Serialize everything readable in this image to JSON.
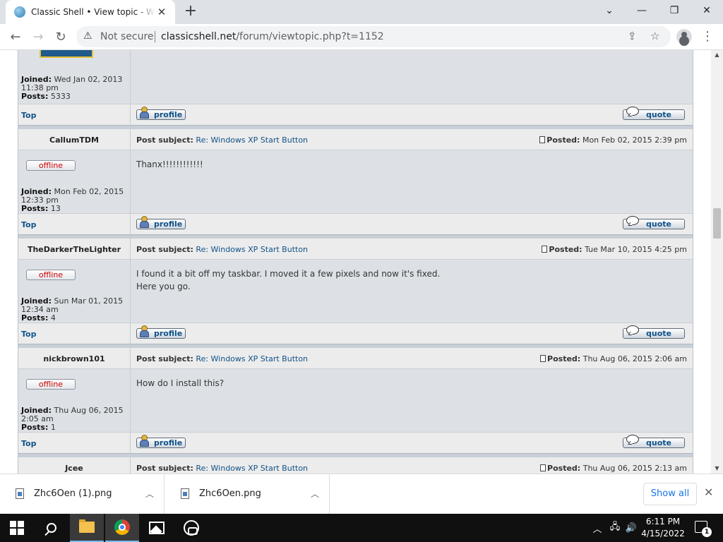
{
  "browser": {
    "tab_title": "Classic Shell • View topic - Windows XP Start Button",
    "new_tab": "+",
    "security_label": "Not secure",
    "url_domain": "classicshell.net",
    "url_path": "/forum/viewtopic.php?t=1152"
  },
  "previous_post_tail": {
    "joined_label": "Joined:",
    "joined": "Wed Jan 02, 2013 11:38 pm",
    "posts_label": "Posts:",
    "posts": "5333"
  },
  "labels": {
    "top": "Top",
    "profile": "profile",
    "quote": "quote",
    "offline": "offline",
    "post_subject": "Post subject:",
    "posted": "Posted:",
    "joined": "Joined:",
    "posts": "Posts:"
  },
  "posts": [
    {
      "author": "CallumTDM",
      "subject": "Re: Windows XP Start Button",
      "posted": "Mon Feb 02, 2015 2:39 pm",
      "joined": "Mon Feb 02, 2015 12:33 pm",
      "post_count": "13",
      "body_lines": [
        "Thanx!!!!!!!!!!!!"
      ]
    },
    {
      "author": "TheDarkerTheLighter",
      "subject": "Re: Windows XP Start Button",
      "posted": "Tue Mar 10, 2015 4:25 pm",
      "joined": "Sun Mar 01, 2015 12:34 am",
      "post_count": "4",
      "body_lines": [
        "I found it a bit off my taskbar. I moved it a few pixels and now it's fixed.",
        "Here you go."
      ]
    },
    {
      "author": "nickbrown101",
      "subject": "Re: Windows XP Start Button",
      "posted": "Thu Aug 06, 2015 2:06 am",
      "joined": "Thu Aug 06, 2015 2:05 am",
      "post_count": "1",
      "body_lines": [
        "How do I install this?"
      ]
    },
    {
      "author": "Jcee",
      "subject": "Re: Windows XP Start Button",
      "posted": "Thu Aug 06, 2015 2:13 am"
    }
  ],
  "downloads": {
    "items": [
      {
        "name": "Zhc6Oen (1).png"
      },
      {
        "name": "Zhc6Oen.png"
      }
    ],
    "show_all": "Show all"
  },
  "taskbar": {
    "time": "6:11 PM",
    "date": "4/15/2022",
    "notification_count": "1"
  },
  "icons": [
    "warning-icon",
    "share-icon",
    "star-icon",
    "profile-icon",
    "menu-icon",
    "post-icon",
    "person-icon",
    "speech-bubble-icon",
    "image-file-icon",
    "windows-logo-icon",
    "search-icon",
    "folder-icon",
    "chrome-icon",
    "photos-icon",
    "snip-icon",
    "network-icon",
    "volume-icon"
  ],
  "colors": {
    "link": "#105289",
    "offline": "#cc0000",
    "post_body_bg": "#dde1e6",
    "header_bg": "#ececec",
    "accent": "#1a73e8"
  }
}
